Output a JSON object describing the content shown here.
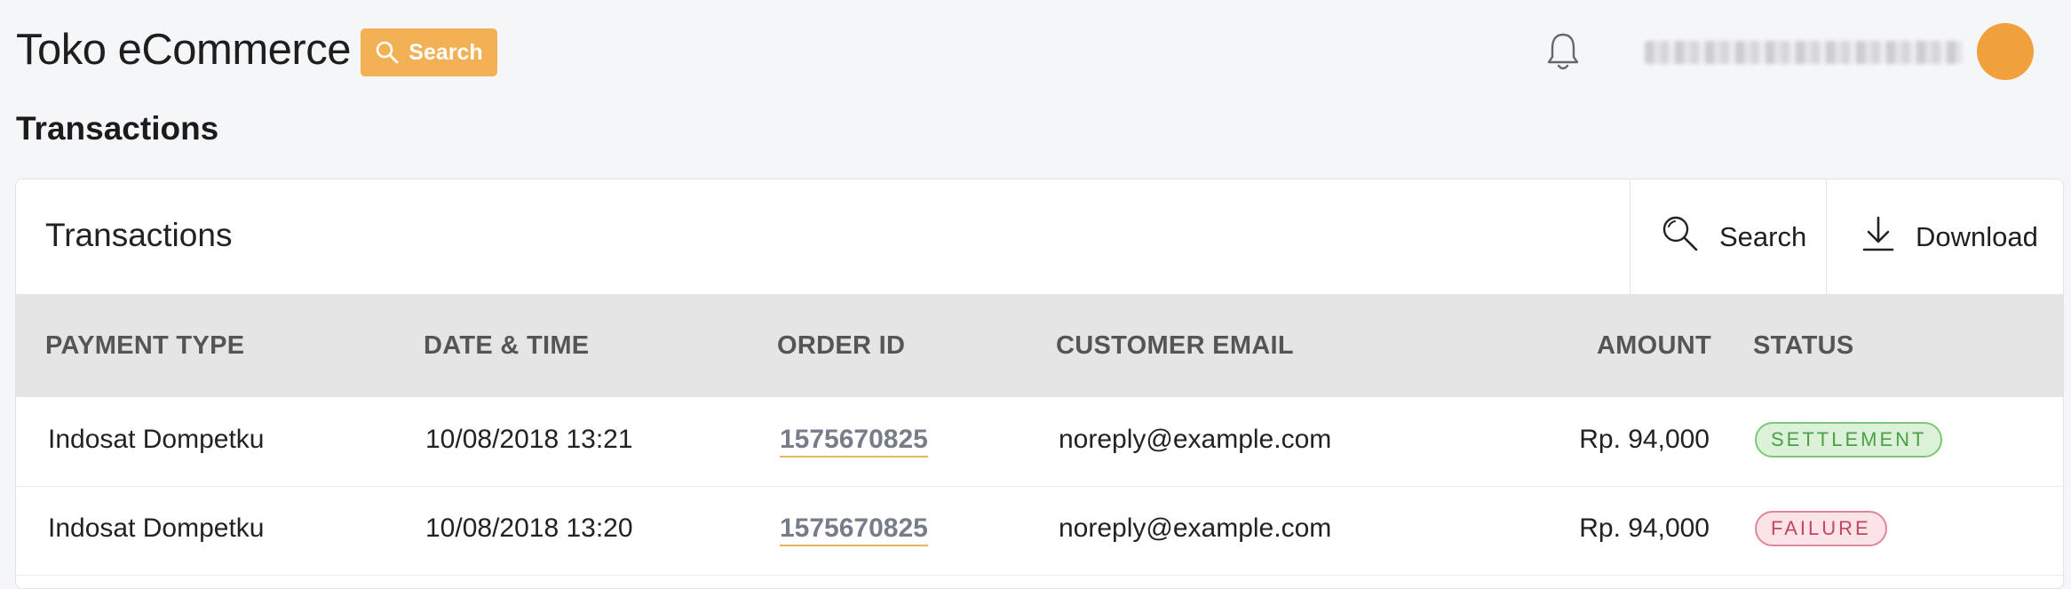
{
  "header": {
    "app_title": "Toko eCommerce",
    "search_label": "Search",
    "search_icon": "search-icon",
    "notification_icon": "bell-icon"
  },
  "page": {
    "title": "Transactions"
  },
  "card": {
    "title": "Transactions",
    "search_label": "Search",
    "download_label": "Download"
  },
  "table": {
    "columns": [
      "PAYMENT TYPE",
      "DATE & TIME",
      "ORDER ID",
      "CUSTOMER EMAIL",
      "AMOUNT",
      "STATUS"
    ],
    "rows": [
      {
        "payment_type": "Indosat Dompetku",
        "datetime": "10/08/2018 13:21",
        "order_id": "1575670825",
        "email": "noreply@example.com",
        "amount": "Rp. 94,000",
        "status": "SETTLEMENT"
      },
      {
        "payment_type": "Indosat Dompetku",
        "datetime": "10/08/2018 13:20",
        "order_id": "1575670825",
        "email": "noreply@example.com",
        "amount": "Rp. 94,000",
        "status": "FAILURE"
      }
    ]
  },
  "colors": {
    "accent": "#f2b154",
    "avatar": "#f0a03c",
    "settlement": "#4c9f47",
    "failure": "#c3455f"
  }
}
